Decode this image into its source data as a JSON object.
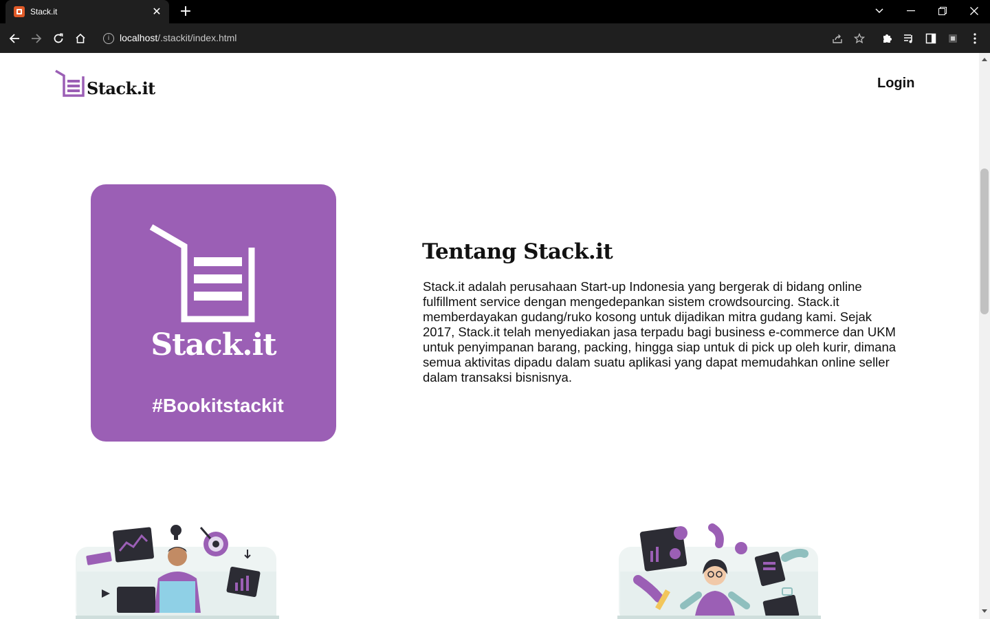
{
  "browser": {
    "tab_title": "Stack.it",
    "url_host": "localhost",
    "url_path": "/.stackit/index.html"
  },
  "header": {
    "logo_text": "Stack.it",
    "login_label": "Login"
  },
  "hero_card": {
    "brand": "Stack.it",
    "hashtag": "#Bookitstackit",
    "bg_color": "#9b5fb5"
  },
  "about": {
    "title": "Tentang Stack.it",
    "body": "Stack.it adalah perusahaan Start-up Indonesia yang bergerak di bidang online fulfillment service dengan mengedepankan sistem crowdsourcing. Stack.it memberdayakan gudang/ruko kosong untuk dijadikan mitra gudang kami. Sejak 2017, Stack.it telah menyediakan jasa terpadu bagi business e-commerce dan UKM untuk penyimpanan barang, packing, hingga siap untuk di pick up oleh kurir, dimana semua aktivitas dipadu dalam suatu aplikasi yang dapat memudahkan online seller dalam transaksi bisnisnya."
  },
  "icons": [
    "favicon-icon",
    "close-icon",
    "plus-icon",
    "chevron-down-icon",
    "minimize-icon",
    "restore-icon",
    "back-icon",
    "forward-icon",
    "reload-icon",
    "home-icon",
    "info-icon",
    "share-icon",
    "star-icon",
    "extensions-icon",
    "media-icon",
    "sidepanel-icon",
    "profile-icon",
    "menu-icon"
  ]
}
